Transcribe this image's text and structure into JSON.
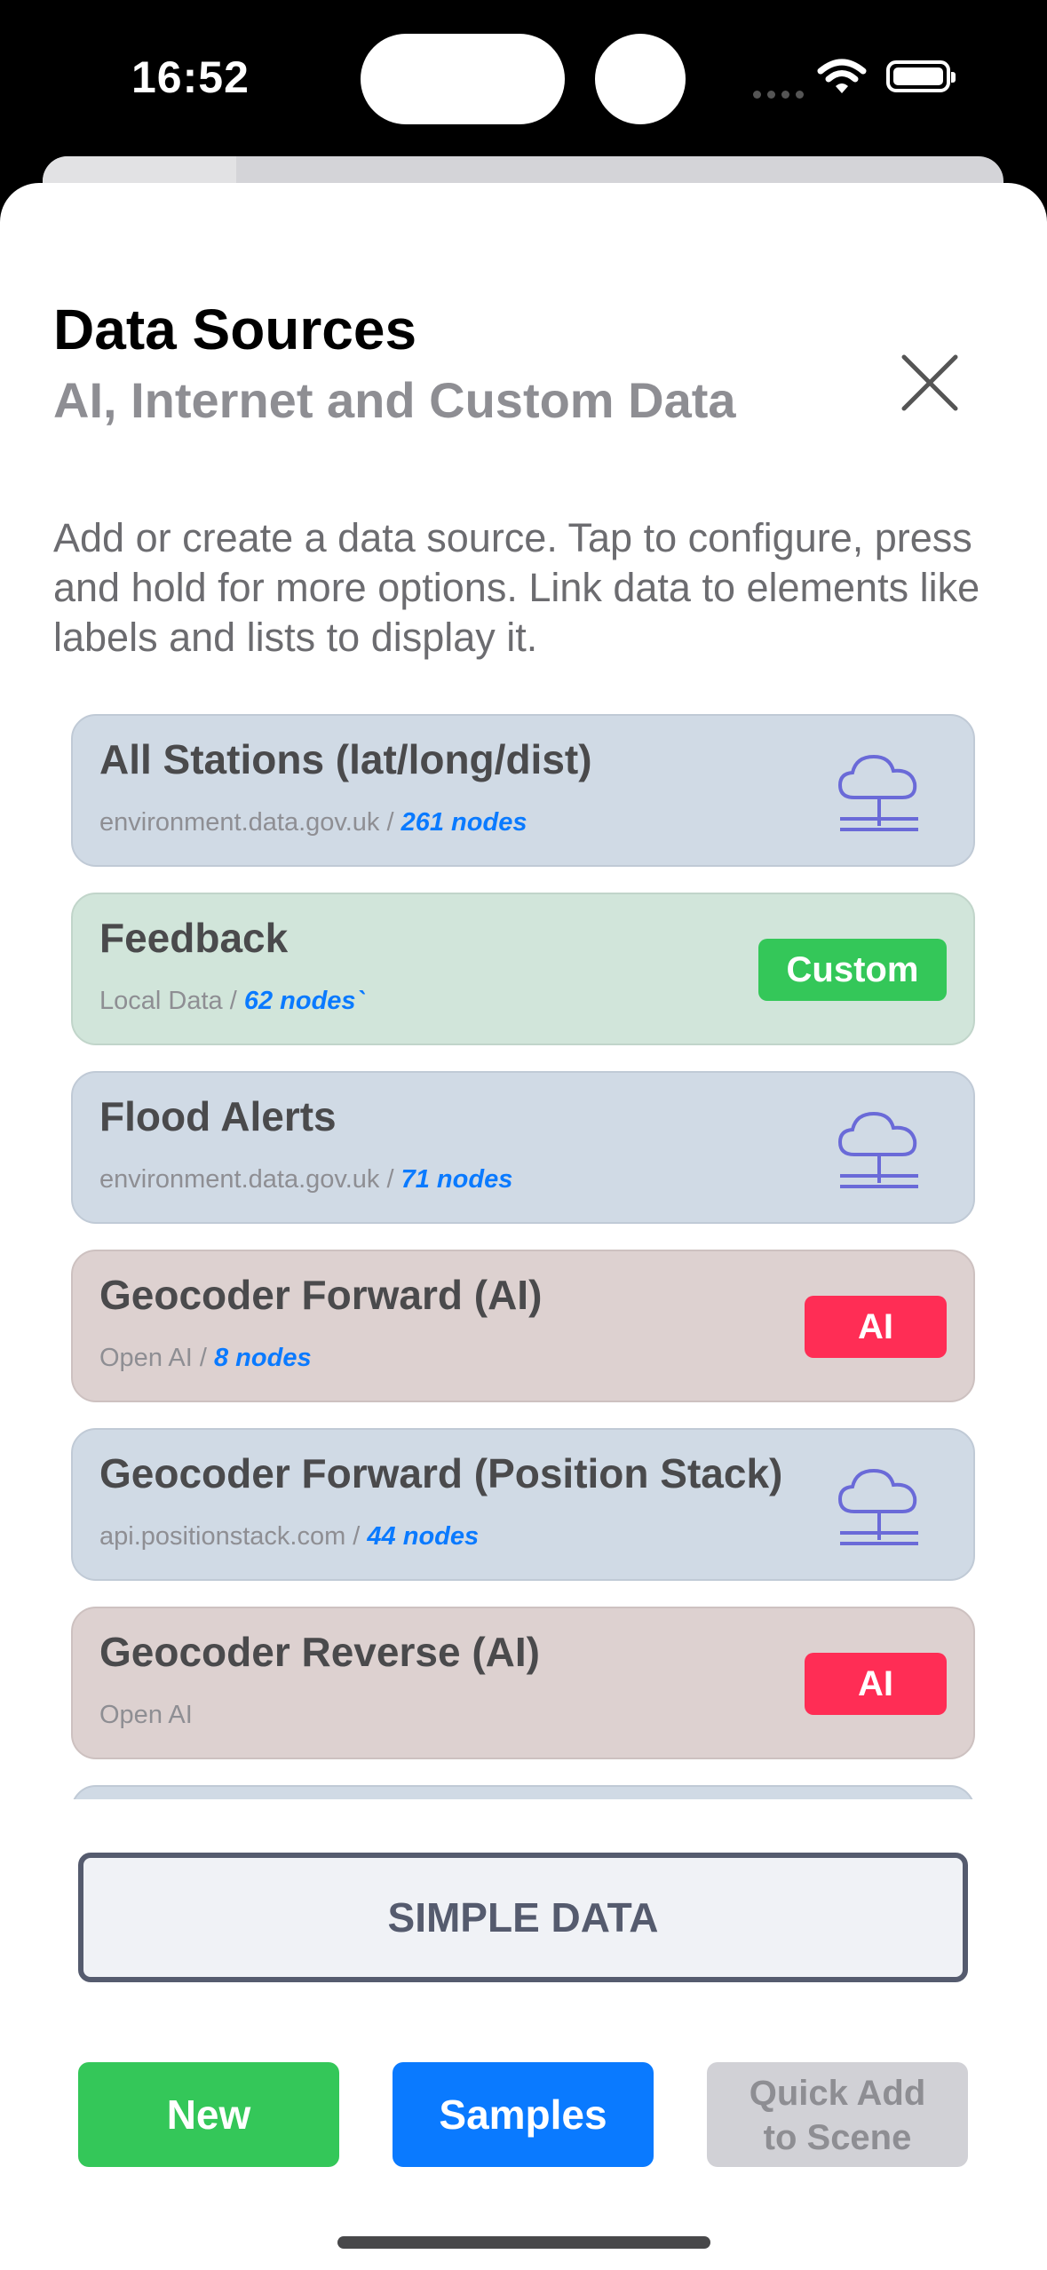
{
  "status_bar": {
    "time": "16:52"
  },
  "header": {
    "title": "Data Sources",
    "subtitle": "AI, Internet and Custom Data"
  },
  "description": "Add or create a data source. Tap to configure, press and hold for more options. Link data to elements like labels and lists to display it.",
  "sources": [
    {
      "title": "All Stations (lat/long/dist)",
      "source": "environment.data.gov.uk / ",
      "nodes": "261 nodes",
      "kind": "web"
    },
    {
      "title": "Feedback",
      "source": "Local Data / ",
      "nodes": "62 nodes`",
      "kind": "custom",
      "badge": "Custom"
    },
    {
      "title": "Flood Alerts",
      "source": "environment.data.gov.uk / ",
      "nodes": "71 nodes",
      "kind": "web"
    },
    {
      "title": "Geocoder Forward (AI)",
      "source": "Open AI / ",
      "nodes": "8 nodes",
      "kind": "ai",
      "badge": "AI"
    },
    {
      "title": "Geocoder Forward (Position Stack)",
      "source": "api.positionstack.com / ",
      "nodes": "44 nodes",
      "kind": "web"
    },
    {
      "title": "Geocoder Reverse (AI)",
      "source": "Open AI",
      "nodes": "",
      "kind": "ai",
      "badge": "AI"
    }
  ],
  "buttons": {
    "simple_data": "SIMPLE DATA",
    "new": "New",
    "samples": "Samples",
    "quick_add_line1": "Quick Add",
    "quick_add_line2": "to Scene"
  },
  "colors": {
    "web_card": "#d0dae5",
    "custom_card": "#d1e5da",
    "ai_card": "#ddd1d0",
    "green": "#34c759",
    "blue": "#0a7aff",
    "red": "#ff2d55"
  }
}
